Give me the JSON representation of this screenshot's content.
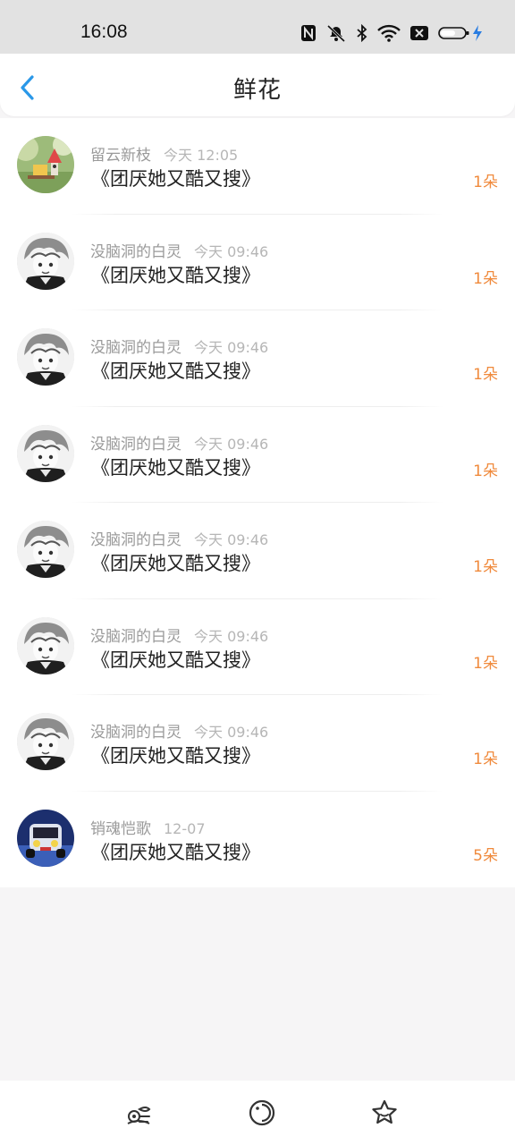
{
  "status_bar": {
    "time": "16:08"
  },
  "header": {
    "title": "鲜花"
  },
  "list": [
    {
      "user": "留云新枝",
      "time": "今天 12:05",
      "book": "《团厌她又酷又搜》",
      "count": "1朵",
      "avatar": "avatar-garden"
    },
    {
      "user": "没脑洞的白灵",
      "time": "今天 09:46",
      "book": "《团厌她又酷又搜》",
      "count": "1朵",
      "avatar": "avatar-anime"
    },
    {
      "user": "没脑洞的白灵",
      "time": "今天 09:46",
      "book": "《团厌她又酷又搜》",
      "count": "1朵",
      "avatar": "avatar-anime"
    },
    {
      "user": "没脑洞的白灵",
      "time": "今天 09:46",
      "book": "《团厌她又酷又搜》",
      "count": "1朵",
      "avatar": "avatar-anime"
    },
    {
      "user": "没脑洞的白灵",
      "time": "今天 09:46",
      "book": "《团厌她又酷又搜》",
      "count": "1朵",
      "avatar": "avatar-anime"
    },
    {
      "user": "没脑洞的白灵",
      "time": "今天 09:46",
      "book": "《团厌她又酷又搜》",
      "count": "1朵",
      "avatar": "avatar-anime"
    },
    {
      "user": "没脑洞的白灵",
      "time": "今天 09:46",
      "book": "《团厌她又酷又搜》",
      "count": "1朵",
      "avatar": "avatar-anime"
    },
    {
      "user": "销魂恺歌",
      "time": "12-07",
      "book": "《团厌她又酷又搜》",
      "count": "5朵",
      "avatar": "avatar-car"
    }
  ],
  "bottom_nav": [
    "flower-icon",
    "planet-icon",
    "star-icon"
  ],
  "colors": {
    "accent_blue": "#2a98e8",
    "count_orange": "#f08a3c"
  }
}
